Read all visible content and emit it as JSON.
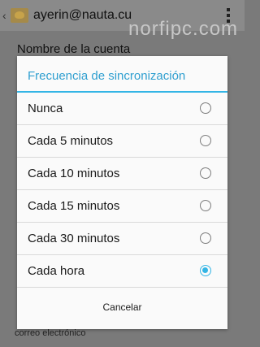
{
  "appbar": {
    "account": "ayerin@nauta.cu"
  },
  "watermark": "norfipc.com",
  "background": {
    "section_title": "Nombre de la cuenta",
    "footer_text": "correo electrónico"
  },
  "dialog": {
    "title": "Frecuencia de sincronización",
    "options": [
      {
        "label": "Nunca",
        "selected": false
      },
      {
        "label": "Cada 5 minutos",
        "selected": false
      },
      {
        "label": "Cada 10 minutos",
        "selected": false
      },
      {
        "label": "Cada 15 minutos",
        "selected": false
      },
      {
        "label": "Cada 30 minutos",
        "selected": false
      },
      {
        "label": "Cada hora",
        "selected": true
      }
    ],
    "cancel_label": "Cancelar"
  },
  "colors": {
    "accent": "#33b5e5",
    "scrim": "#7a7a7a"
  },
  "icons": {
    "back": "back-icon",
    "app": "email-app-icon",
    "menu": "overflow-menu-icon"
  }
}
